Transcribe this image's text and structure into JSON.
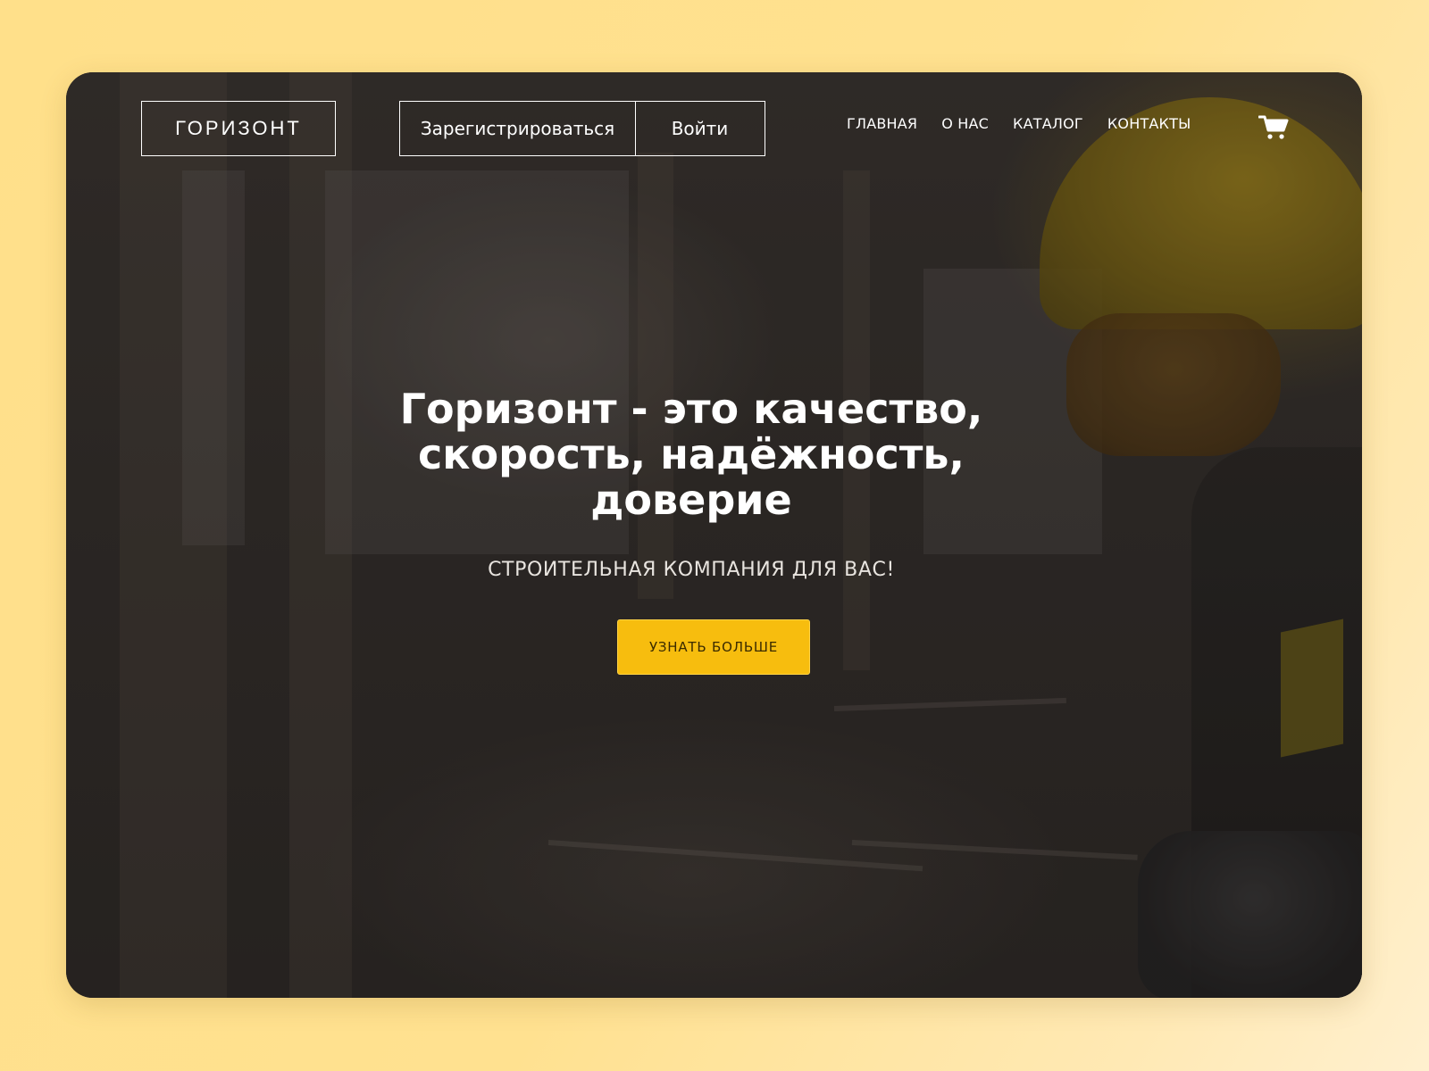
{
  "header": {
    "logo": "ГОРИЗОНТ",
    "register_label": "Зарегистрироваться",
    "login_label": "Войти",
    "nav": [
      {
        "label": "ГЛАВНАЯ"
      },
      {
        "label": "О НАС"
      },
      {
        "label": "КАТАЛОГ"
      },
      {
        "label": "КОНТАКТЫ"
      }
    ],
    "cart_icon": "shopping-cart-icon"
  },
  "hero": {
    "title_line1": "Горизонт - это качество,",
    "title_line2": "скорость, надёжность,",
    "title_line3": "доверие",
    "subtitle": "СТРОИТЕЛЬНАЯ КОМПАНИЯ ДЛЯ ВАС!",
    "cta_label": "УЗНАТЬ БОЛЬШЕ"
  },
  "colors": {
    "page_background": "#ffe08a",
    "accent": "#f7bd0e",
    "text_light": "#ffffff"
  }
}
